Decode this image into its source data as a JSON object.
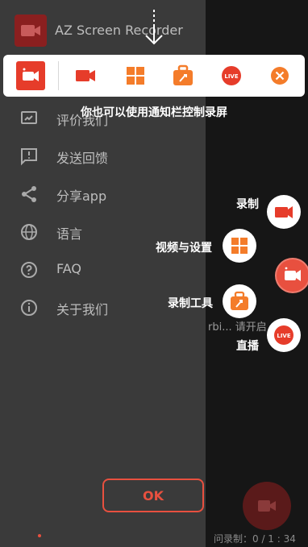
{
  "app": {
    "title": "AZ Screen Recorder"
  },
  "drawer": {
    "items": [
      {
        "label": "评价我们",
        "icon": "rate-icon"
      },
      {
        "label": "发送回馈",
        "icon": "feedback-icon"
      },
      {
        "label": "分享app",
        "icon": "share-icon"
      },
      {
        "label": "语言",
        "icon": "globe-icon"
      },
      {
        "label": "FAQ",
        "icon": "help-icon"
      },
      {
        "label": "关于我们",
        "icon": "info-icon"
      }
    ]
  },
  "obscured": {
    "middle": "rbi... 请开启",
    "bottom": "问录制：0 / 1 : 34"
  },
  "overlay": {
    "hint": "你也可以使用通知栏控制录屏",
    "notification_items": [
      "app-icon",
      "record-icon",
      "grid-icon",
      "toolbox-icon",
      "live-icon",
      "close-icon"
    ],
    "live_badge": "LIVE",
    "fab_menu": [
      {
        "label": "录制",
        "icon": "record-icon"
      },
      {
        "label": "视频与设置",
        "icon": "grid-icon"
      },
      {
        "label": "录制工具",
        "icon": "toolbox-icon"
      },
      {
        "label": "直播",
        "icon": "live-icon",
        "badge": "LIVE"
      }
    ],
    "ok_label": "OK"
  },
  "colors": {
    "accent": "#e8503f",
    "orange": "#f47c2a",
    "dimmed_bg": "#3a3a3a"
  }
}
